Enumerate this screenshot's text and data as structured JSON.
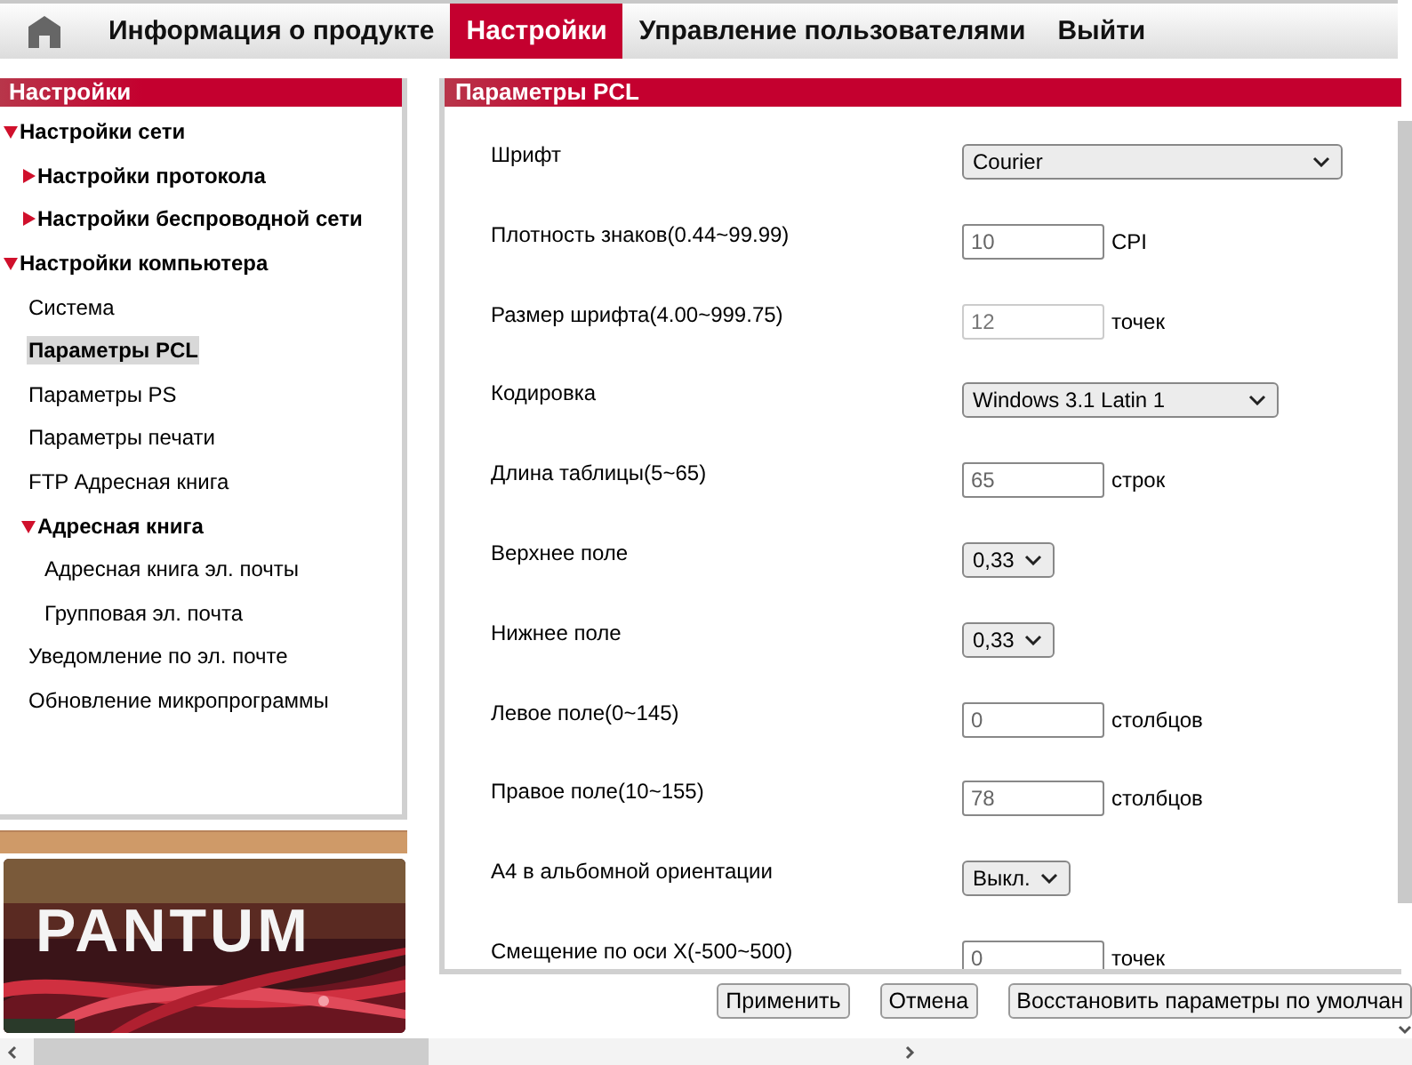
{
  "nav": {
    "tabs": [
      {
        "label": "Информация о продукте",
        "selected": false
      },
      {
        "label": "Настройки",
        "selected": true
      },
      {
        "label": "Управление пользователями",
        "selected": false
      },
      {
        "label": "Выйти",
        "selected": false
      }
    ]
  },
  "sidebar": {
    "title": "Настройки",
    "items": [
      {
        "label": "Настройки сети",
        "kind": "group",
        "expanded": true,
        "children": [
          {
            "label": "Настройки протокола",
            "kind": "group",
            "expanded": false
          },
          {
            "label": "Настройки беспроводной сети",
            "kind": "group",
            "expanded": false
          }
        ]
      },
      {
        "label": "Настройки компьютера",
        "kind": "group",
        "expanded": true,
        "children": [
          {
            "label": "Система",
            "kind": "page",
            "selected": false
          },
          {
            "label": "Параметры PCL",
            "kind": "page",
            "selected": true
          },
          {
            "label": "Параметры PS",
            "kind": "page",
            "selected": false
          },
          {
            "label": "Параметры печати",
            "kind": "page",
            "selected": false
          },
          {
            "label": "FTP Адресная книга",
            "kind": "page",
            "selected": false
          },
          {
            "label": "Адресная книга",
            "kind": "group",
            "expanded": true,
            "children": [
              {
                "label": "Адресная книга эл. почты",
                "kind": "page",
                "selected": false
              },
              {
                "label": "Групповая эл. почта",
                "kind": "page",
                "selected": false
              }
            ]
          },
          {
            "label": "Уведомление по эл. почте",
            "kind": "page",
            "selected": false
          },
          {
            "label": "Обновление микропрограммы",
            "kind": "page",
            "selected": false
          }
        ]
      }
    ]
  },
  "logo": {
    "text": "PANTUM"
  },
  "panel": {
    "title": "Параметры PCL",
    "rows": [
      {
        "label": "Шрифт",
        "kind": "select",
        "value": "Courier"
      },
      {
        "label": "Плотность знаков(0.44~99.99)",
        "kind": "input",
        "value": "10",
        "unit": "CPI"
      },
      {
        "label": "Размер шрифта(4.00~999.75)",
        "kind": "input",
        "value": "12",
        "unit": "точек",
        "disabled": true
      },
      {
        "label": "Кодировка",
        "kind": "select",
        "value": "Windows 3.1 Latin 1"
      },
      {
        "label": "Длина таблицы(5~65)",
        "kind": "input",
        "value": "65",
        "unit": "строк"
      },
      {
        "label": "Верхнее поле",
        "kind": "select",
        "value": "0,33"
      },
      {
        "label": "Нижнее поле",
        "kind": "select",
        "value": "0,33"
      },
      {
        "label": "Левое поле(0~145)",
        "kind": "input",
        "value": "0",
        "unit": "столбцов"
      },
      {
        "label": "Правое поле(10~155)",
        "kind": "input",
        "value": "78",
        "unit": "столбцов"
      },
      {
        "label": "A4 в альбомной ориентации",
        "kind": "select",
        "value": "Выкл."
      },
      {
        "label": "Смещение по оси X(-500~500)",
        "kind": "input",
        "value": "0",
        "unit": "точек"
      }
    ]
  },
  "buttons": [
    "Применить",
    "Отмена",
    "Восстановить параметры по умолчан"
  ]
}
